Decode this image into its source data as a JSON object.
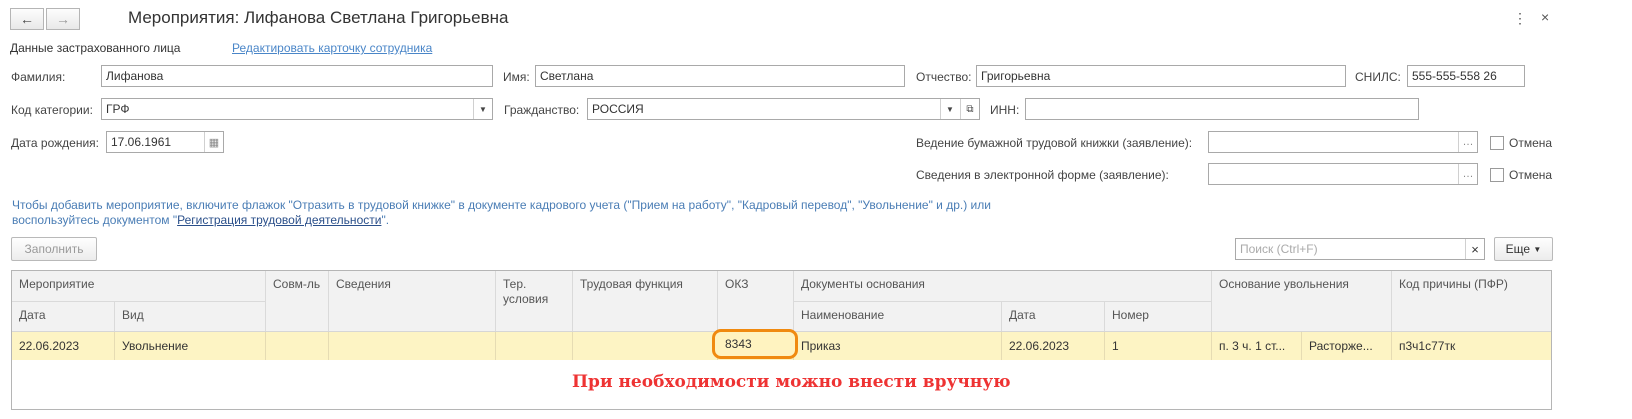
{
  "window": {
    "title": "Мероприятия: Лифанова Светлана Григорьевна",
    "back_icon": "←",
    "forward_icon": "→",
    "more_icon": "⋮",
    "close_icon": "×"
  },
  "insured": {
    "section_label": "Данные застрахованного лица",
    "edit_link": "Редактировать карточку сотрудника",
    "surname_label": "Фамилия:",
    "surname": "Лифанова",
    "name_label": "Имя:",
    "name": "Светлана",
    "patronymic_label": "Отчество:",
    "patronymic": "Григорьевна",
    "snils_label": "СНИЛС:",
    "snils": "555-555-558 26",
    "category_label": "Код категории:",
    "category": "ГРФ",
    "citizenship_label": "Гражданство:",
    "citizenship": "РОССИЯ",
    "inn_label": "ИНН:",
    "inn": "",
    "birth_label": "Дата рождения:",
    "birth": "17.06.1961",
    "paper_book_label": "Ведение бумажной трудовой книжки (заявление):",
    "paper_book": "",
    "electronic_label": "Сведения в электронной форме (заявление):",
    "electronic": "",
    "cancel_label": "Отмена"
  },
  "hint": {
    "text": "Чтобы добавить мероприятие, включите флажок \"Отразить в трудовой книжке\" в документе кадрового учета (\"Прием на работу\", \"Кадровый перевод\", \"Увольнение\" и др.) или воспользуйтесь документом \"",
    "link": "Регистрация трудовой деятельности",
    "tail": "\"."
  },
  "toolbar": {
    "fill_button": "Заполнить",
    "search_placeholder": "Поиск (Ctrl+F)",
    "clear_icon": "×",
    "more_button": "Еще"
  },
  "table": {
    "headers": {
      "event": "Мероприятие",
      "date": "Дата",
      "kind": "Вид",
      "combined": "Совм-ль",
      "info": "Сведения",
      "terr": "Тер. условия",
      "function": "Трудовая функция",
      "okz": "ОКЗ",
      "docs": "Документы основания",
      "doc_name": "Наименование",
      "doc_date": "Дата",
      "doc_number": "Номер",
      "dismissal_basis": "Основание увольнения",
      "reason_code": "Код причины (ПФР)"
    },
    "row": {
      "date": "22.06.2023",
      "kind": "Увольнение",
      "combined": "",
      "info": "",
      "terr": "",
      "function": "",
      "okz": "8343",
      "doc_name": "Приказ",
      "doc_date": "22.06.2023",
      "doc_number": "1",
      "basis_article": "п. 3 ч. 1 ст...",
      "basis_text": "Расторже...",
      "reason_code": "п3ч1с77тк"
    }
  },
  "annotation": "При необходимости можно внести вручную",
  "colors": {
    "highlight_row": "#fdf4c4",
    "annotation": "#e33333",
    "callout": "#f08a10"
  }
}
